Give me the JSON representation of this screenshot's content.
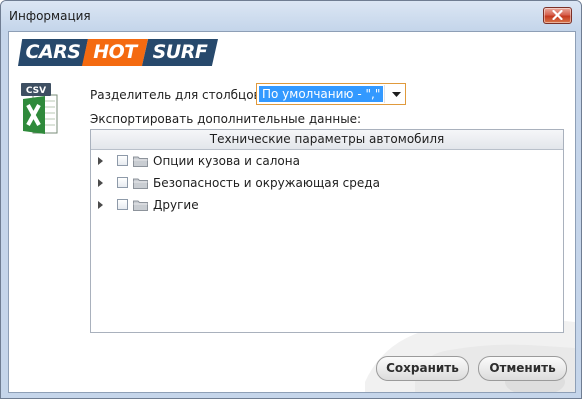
{
  "window": {
    "title": "Информация"
  },
  "logo": {
    "part1": "CARS",
    "part2": "HOT",
    "part3": "SURF"
  },
  "csv_icon": {
    "label": "CSV"
  },
  "separator": {
    "label": "Разделитель для столбцов:",
    "value": "По умолчанию - \",\""
  },
  "export": {
    "label": "Экспортировать дополнительные данные:"
  },
  "tree": {
    "header": "Технические параметры автомобиля",
    "items": [
      {
        "label": "Опции кузова и салона",
        "checked": false
      },
      {
        "label": "Безопасность и окружающая среда",
        "checked": false
      },
      {
        "label": "Другие",
        "checked": false
      }
    ]
  },
  "buttons": {
    "save": "Сохранить",
    "cancel": "Отменить"
  },
  "colors": {
    "accent": "#f46a10",
    "brand": "#27496c",
    "selection": "#3399ff"
  },
  "icons": [
    "close-icon",
    "csv-file-icon",
    "expand-arrow-icon",
    "folder-icon",
    "dropdown-arrow-icon"
  ]
}
